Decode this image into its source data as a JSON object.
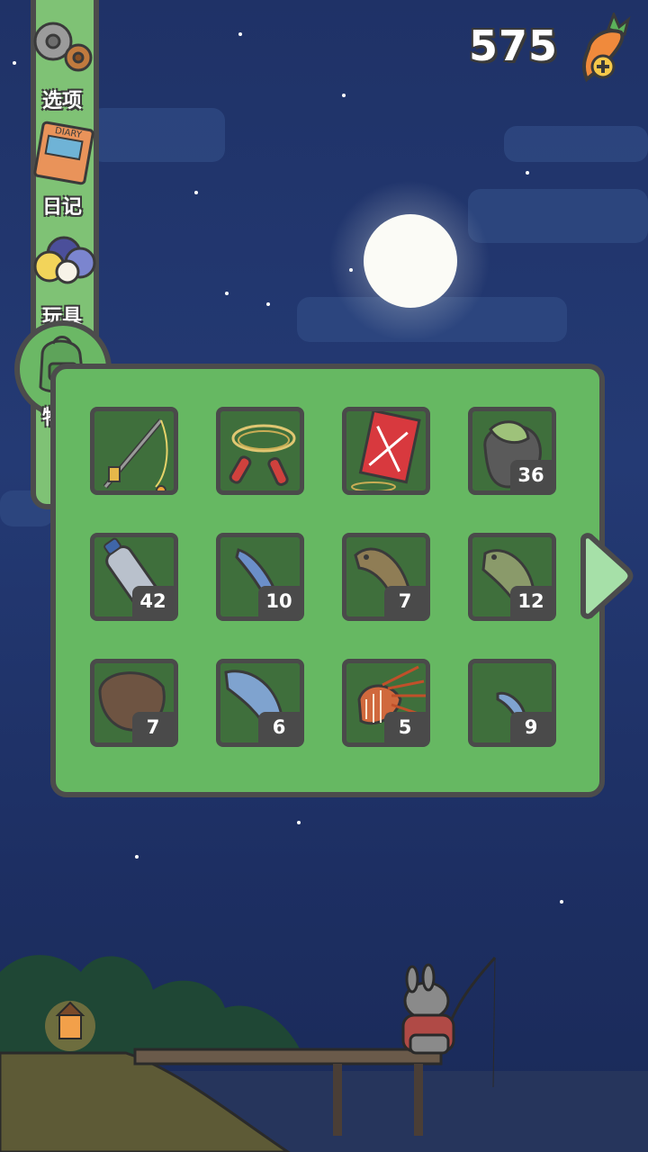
{
  "currency": {
    "amount": "575",
    "icon": "carrot-plus-icon"
  },
  "sidebar": {
    "items": [
      {
        "label": "选项",
        "icon": "gears-icon"
      },
      {
        "label": "日记",
        "icon": "diary-icon"
      },
      {
        "label": "玩具",
        "icon": "toys-icon"
      },
      {
        "label": "物品",
        "icon": "backpack-icon",
        "active": true
      }
    ],
    "diary_cover_text": "DIARY"
  },
  "inventory": {
    "slots": [
      {
        "item": "fishing-rod",
        "count": ""
      },
      {
        "item": "jump-rope",
        "count": ""
      },
      {
        "item": "kite",
        "count": ""
      },
      {
        "item": "trash-bag",
        "count": "36"
      },
      {
        "item": "plastic-bottle",
        "count": "42"
      },
      {
        "item": "sardine",
        "count": "10"
      },
      {
        "item": "catfish",
        "count": "7"
      },
      {
        "item": "bass",
        "count": "12"
      },
      {
        "item": "flounder",
        "count": "7"
      },
      {
        "item": "salmon",
        "count": "6"
      },
      {
        "item": "lionfish",
        "count": "5"
      },
      {
        "item": "small-fish",
        "count": "9"
      }
    ]
  },
  "colors": {
    "panel": "#66b862",
    "slot": "#3f6f3c",
    "outline": "#4a4a4a",
    "sky": "#213670"
  }
}
